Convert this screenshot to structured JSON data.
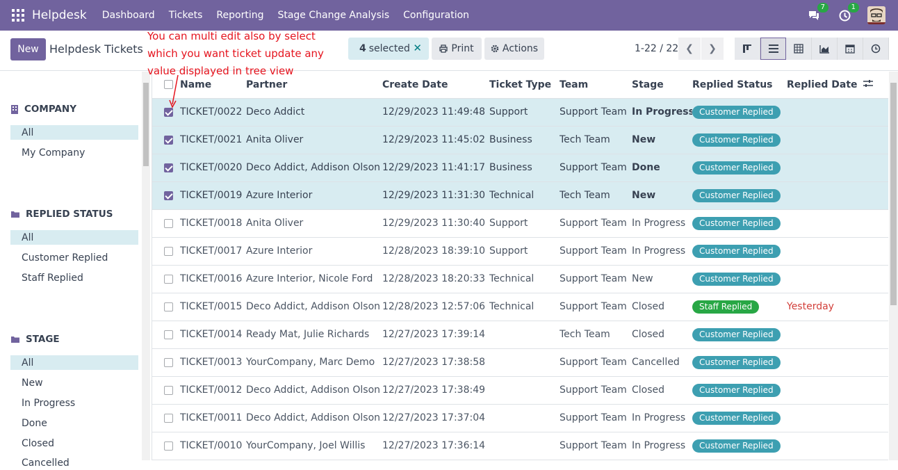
{
  "navbar": {
    "brand": "Helpdesk",
    "menu": [
      "Dashboard",
      "Tickets",
      "Reporting",
      "Stage Change Analysis",
      "Configuration"
    ],
    "messages_count": "7",
    "activities_count": "1"
  },
  "control": {
    "new_label": "New",
    "title": "Helpdesk Tickets",
    "annotation": "You can multi edit also by select which you want ticket update any value displayed in tree view",
    "selected_count": "4",
    "selected_label": "selected",
    "print_label": "Print",
    "actions_label": "Actions",
    "pager": "1-22 / 22"
  },
  "sidebar": {
    "company_title": "COMPANY",
    "company_items": [
      "All",
      "My Company"
    ],
    "replied_title": "REPLIED STATUS",
    "replied_items": [
      "All",
      "Customer Replied",
      "Staff Replied"
    ],
    "stage_title": "STAGE",
    "stage_items": [
      "All",
      "New",
      "In Progress",
      "Done",
      "Closed",
      "Cancelled"
    ]
  },
  "table": {
    "columns": [
      "Name",
      "Partner",
      "Create Date",
      "Ticket Type",
      "Team",
      "Stage",
      "Replied Status",
      "Replied Date"
    ],
    "rows": [
      {
        "selected": true,
        "name": "TICKET/0022",
        "partner": "Deco Addict",
        "date": "12/29/2023 11:49:48",
        "type": "Support",
        "team": "Support Team",
        "stage": "In Progress",
        "status": "Customer Replied",
        "replied": ""
      },
      {
        "selected": true,
        "name": "TICKET/0021",
        "partner": "Anita Oliver",
        "date": "12/29/2023 11:45:02",
        "type": "Business",
        "team": "Tech Team",
        "stage": "New",
        "status": "Customer Replied",
        "replied": ""
      },
      {
        "selected": true,
        "name": "TICKET/0020",
        "partner": "Deco Addict, Addison Olson",
        "date": "12/29/2023 11:41:17",
        "type": "Business",
        "team": "Support Team",
        "stage": "Done",
        "status": "Customer Replied",
        "replied": ""
      },
      {
        "selected": true,
        "name": "TICKET/0019",
        "partner": "Azure Interior",
        "date": "12/29/2023 11:31:30",
        "type": "Technical",
        "team": "Tech Team",
        "stage": "New",
        "status": "Customer Replied",
        "replied": ""
      },
      {
        "selected": false,
        "name": "TICKET/0018",
        "partner": "Anita Oliver",
        "date": "12/29/2023 11:30:40",
        "type": "Support",
        "team": "Support Team",
        "stage": "In Progress",
        "status": "Customer Replied",
        "replied": ""
      },
      {
        "selected": false,
        "name": "TICKET/0017",
        "partner": "Azure Interior",
        "date": "12/28/2023 18:39:10",
        "type": "Support",
        "team": "Support Team",
        "stage": "In Progress",
        "status": "Customer Replied",
        "replied": ""
      },
      {
        "selected": false,
        "name": "TICKET/0016",
        "partner": "Azure Interior, Nicole Ford",
        "date": "12/28/2023 18:20:33",
        "type": "Technical",
        "team": "Support Team",
        "stage": "New",
        "status": "Customer Replied",
        "replied": ""
      },
      {
        "selected": false,
        "name": "TICKET/0015",
        "partner": "Deco Addict, Addison Olson",
        "date": "12/28/2023 12:57:06",
        "type": "Technical",
        "team": "Support Team",
        "stage": "Closed",
        "status": "Staff Replied",
        "replied": "Yesterday"
      },
      {
        "selected": false,
        "name": "TICKET/0014",
        "partner": "Ready Mat, Julie Richards",
        "date": "12/27/2023 17:39:14",
        "type": "",
        "team": "Tech Team",
        "stage": "Closed",
        "status": "Customer Replied",
        "replied": ""
      },
      {
        "selected": false,
        "name": "TICKET/0013",
        "partner": "YourCompany, Marc Demo",
        "date": "12/27/2023 17:38:58",
        "type": "",
        "team": "Support Team",
        "stage": "Cancelled",
        "status": "Customer Replied",
        "replied": ""
      },
      {
        "selected": false,
        "name": "TICKET/0012",
        "partner": "Deco Addict, Addison Olson",
        "date": "12/27/2023 17:38:49",
        "type": "",
        "team": "Support Team",
        "stage": "Closed",
        "status": "Customer Replied",
        "replied": ""
      },
      {
        "selected": false,
        "name": "TICKET/0011",
        "partner": "Deco Addict, Addison Olson",
        "date": "12/27/2023 17:37:04",
        "type": "",
        "team": "Support Team",
        "stage": "In Progress",
        "status": "Customer Replied",
        "replied": ""
      },
      {
        "selected": false,
        "name": "TICKET/0010",
        "partner": "YourCompany, Joel Willis",
        "date": "12/27/2023 17:36:14",
        "type": "",
        "team": "Support Team",
        "stage": "In Progress",
        "status": "Customer Replied",
        "replied": ""
      }
    ]
  },
  "colors": {
    "brand": "#71639e",
    "selected_row": "#d8ecf1",
    "customer_badge": "#3d9fb1",
    "staff_badge": "#28a745",
    "annotation": "#e5141e"
  }
}
